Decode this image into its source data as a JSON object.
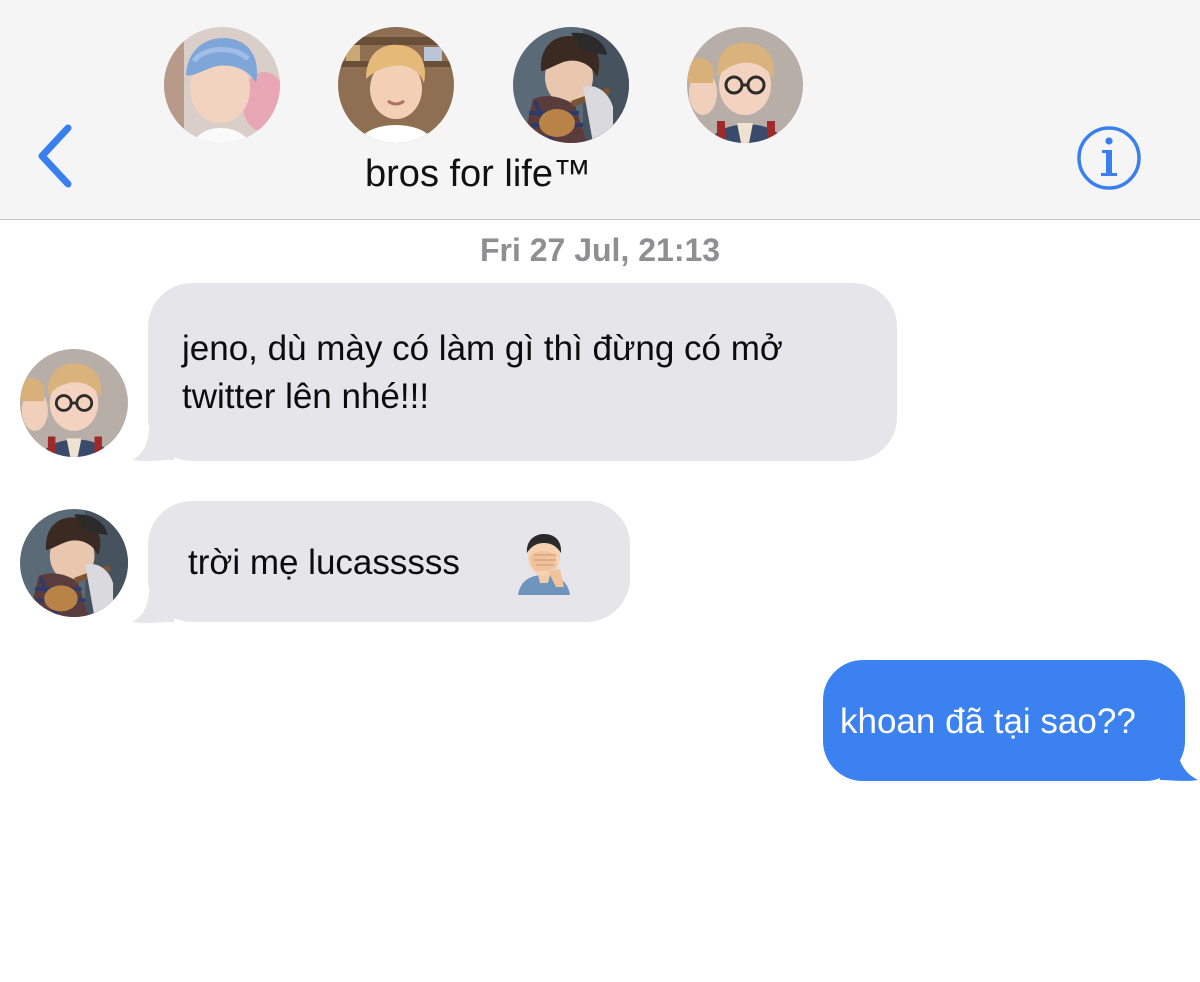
{
  "header": {
    "back_icon": "chevron-left-icon",
    "info_icon": "info-icon",
    "title": "bros for life™",
    "accent_color": "#3a7ff0",
    "participants": [
      {
        "avatar": "participant-avatar-blue-hair"
      },
      {
        "avatar": "participant-avatar-blonde"
      },
      {
        "avatar": "participant-avatar-guitar"
      },
      {
        "avatar": "participant-avatar-glasses"
      }
    ]
  },
  "conversation": {
    "timestamp": "Fri 27 Jul, 21:13",
    "messages": [
      {
        "direction": "received",
        "sender_avatar": "participant-avatar-glasses",
        "lines": [
          "jeno, dù mày có làm gì thì đừng có mở",
          "twitter lên nhé!!!"
        ]
      },
      {
        "direction": "received",
        "sender_avatar": "participant-avatar-guitar",
        "text": "trời mẹ lucasssss",
        "emoji": "face-palm-emoji"
      },
      {
        "direction": "sent",
        "text": "khoan đã tại sao??"
      }
    ]
  },
  "colors": {
    "received_bubble": "#e5e5ea",
    "sent_bubble": "#3b82f0",
    "timestamp": "#8e8e93",
    "header_bg": "#f5f5f5"
  }
}
